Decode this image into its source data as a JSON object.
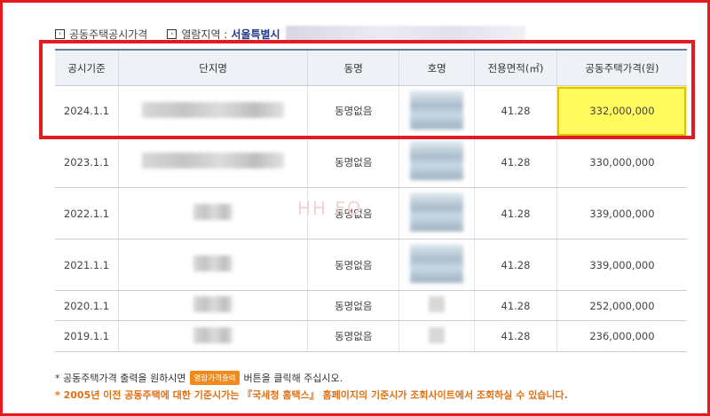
{
  "breadcrumb": {
    "item1": "공동주택공시가격",
    "item2_label": "열람지역 :",
    "item2_value": "서울특별시"
  },
  "table": {
    "headers": [
      "공시기준",
      "단지명",
      "동명",
      "호명",
      "전용면적(㎡)",
      "공동주택가격(원)"
    ],
    "rows": [
      {
        "date": "2024.1.1",
        "dong": "동명없음",
        "area": "41.28",
        "price": "332,000,000"
      },
      {
        "date": "2023.1.1",
        "dong": "동명없음",
        "area": "41.28",
        "price": "330,000,000"
      },
      {
        "date": "2022.1.1",
        "dong": "동명없음",
        "area": "41.28",
        "price": "339,000,000"
      },
      {
        "date": "2021.1.1",
        "dong": "동명없음",
        "area": "41.28",
        "price": "339,000,000"
      },
      {
        "date": "2020.1.1",
        "dong": "동명없음",
        "area": "41.28",
        "price": "252,000,000"
      },
      {
        "date": "2019.1.1",
        "dong": "동명없음",
        "area": "41.28",
        "price": "236,000,000"
      }
    ]
  },
  "watermark": "HH FO",
  "notes": {
    "line1_prefix": "* 공동주택가격 출력을 원하시면",
    "print_button": "열람가격출력",
    "line1_suffix": "버튼을 클릭해 주십시오.",
    "line2": "* 2005년 이전 공동주택에 대한 기준시가는 『국세청 홈택스』 홈페이지의 기준시가 조회사이트에서 조회하실 수 있습니다."
  },
  "colors": {
    "frame_border": "#e8181f",
    "highlight": "#fffb5c",
    "header_bg": "#eef1f6",
    "note_orange": "#e07014",
    "region_blue": "#1e3a8a"
  }
}
